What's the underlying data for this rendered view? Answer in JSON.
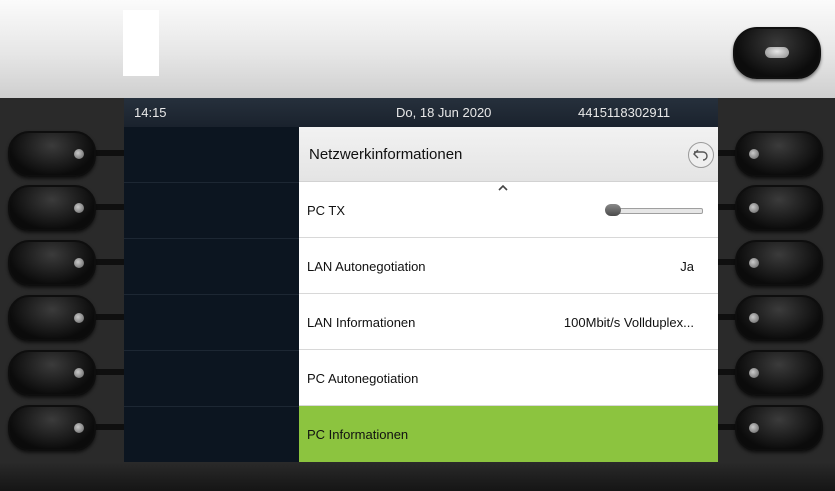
{
  "status": {
    "time": "14:15",
    "date": "Do, 18 Jun 2020",
    "number": "4415118302911"
  },
  "title": "Netzwerkinformationen",
  "rows": [
    {
      "label": "PC TX",
      "value": "",
      "slider_value": 0
    },
    {
      "label": "LAN Autonegotiation",
      "value": "Ja"
    },
    {
      "label": "LAN Informationen",
      "value": "100Mbit/s Vollduplex..."
    },
    {
      "label": "PC Autonegotiation",
      "value": ""
    },
    {
      "label": "PC Informationen",
      "value": ""
    }
  ],
  "selected_row": "PC Informationen",
  "colors": {
    "selection": "#8cc43f",
    "status_bar": "#1f2833",
    "panel_bg": "#ffffff"
  },
  "icons": {
    "back": "back-arrow-icon",
    "scroll_up": "chevron-up-icon",
    "home": "home-key-icon"
  }
}
